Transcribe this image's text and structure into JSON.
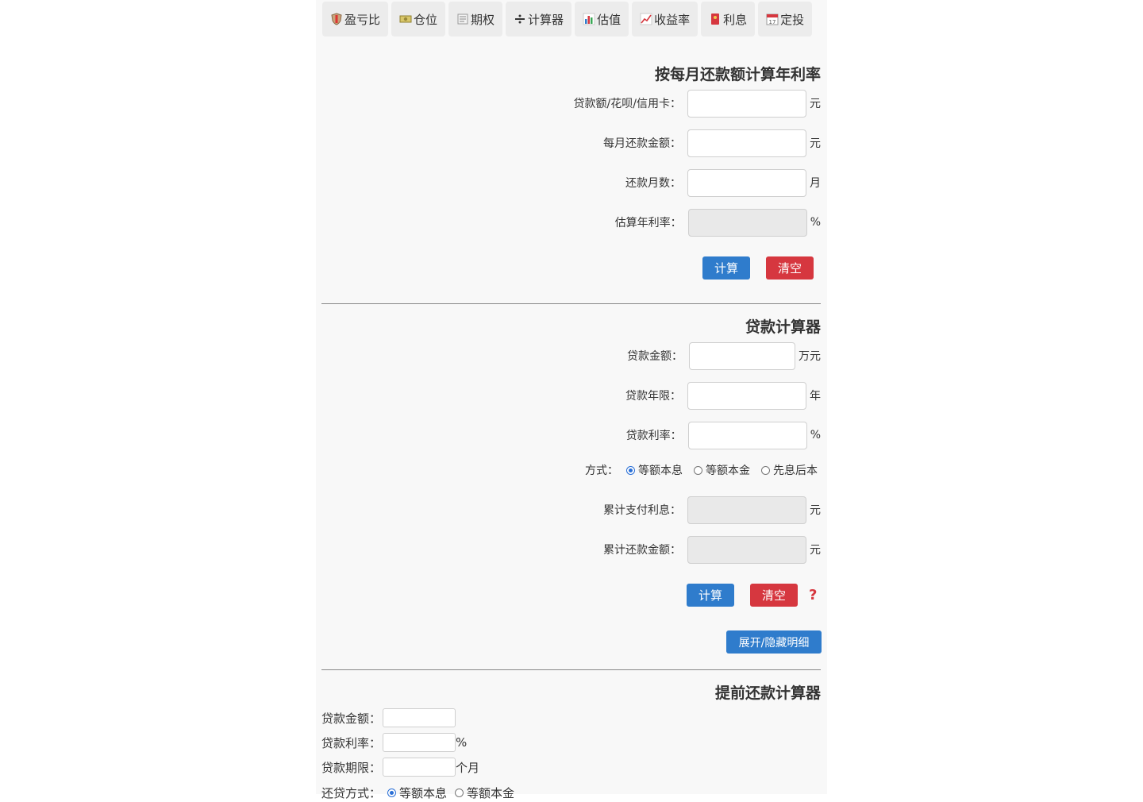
{
  "tabs": [
    {
      "label": "盈亏比",
      "icon": "shield-icon"
    },
    {
      "label": "仓位",
      "icon": "money-icon"
    },
    {
      "label": "期权",
      "icon": "newspaper-icon"
    },
    {
      "label": "计算器",
      "icon": "divide-icon"
    },
    {
      "label": "估值",
      "icon": "bar-chart-icon"
    },
    {
      "label": "收益率",
      "icon": "trend-chart-icon"
    },
    {
      "label": "利息",
      "icon": "red-envelope-icon"
    },
    {
      "label": "定投",
      "icon": "calendar-icon"
    }
  ],
  "rate_calc": {
    "title": "按每月还款额计算年利率",
    "loan_label": "贷款额/花呗/信用卡：",
    "loan_unit": "元",
    "monthly_label": "每月还款金额：",
    "monthly_unit": "元",
    "months_label": "还款月数：",
    "months_unit": "月",
    "annual_label": "估算年利率：",
    "annual_unit": "%",
    "calc_button": "计算",
    "clear_button": "清空"
  },
  "loan_calc": {
    "title": "贷款计算器",
    "amount_label": "贷款金额：",
    "amount_unit": "万元",
    "years_label": "贷款年限：",
    "years_unit": "年",
    "rate_label": "贷款利率：",
    "rate_unit": "%",
    "method_label": "方式：",
    "methods": [
      "等额本息",
      "等额本金",
      "先息后本"
    ],
    "selected_method": "等额本息",
    "interest_label": "累计支付利息：",
    "interest_unit": "元",
    "total_label": "累计还款金额：",
    "total_unit": "元",
    "calc_button": "计算",
    "clear_button": "清空",
    "help": "?",
    "toggle_button": "展开/隐藏明细"
  },
  "prepay_calc": {
    "title": "提前还款计算器",
    "amount_label": "贷款金额：",
    "rate_label": "贷款利率：",
    "rate_unit": "%",
    "term_label": "贷款期限：",
    "term_unit": "个月",
    "method_label": "还贷方式：",
    "methods": [
      "等额本息",
      "等额本金"
    ]
  }
}
